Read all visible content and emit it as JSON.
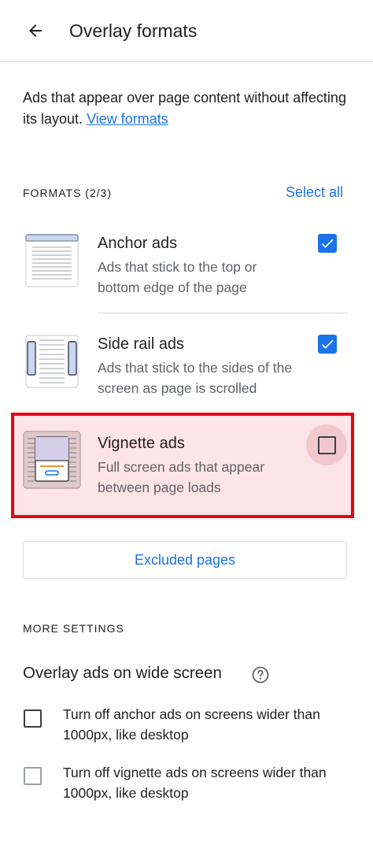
{
  "header": {
    "title": "Overlay formats",
    "back_icon": "arrow-back-icon"
  },
  "intro": {
    "text": "Ads that appear over page content without affecting its layout.",
    "link_label": "View formats"
  },
  "formats_section": {
    "label": "FORMATS (2/3)",
    "select_all_label": "Select all",
    "items": [
      {
        "name": "Anchor ads",
        "description": "Ads that stick to the top or bottom edge of the page",
        "checked": true,
        "thumbnail_icon": "anchor-ads-thumbnail-icon"
      },
      {
        "name": "Side rail ads",
        "description": "Ads that stick to the sides of the screen as page is scrolled",
        "checked": true,
        "thumbnail_icon": "side-rail-ads-thumbnail-icon"
      },
      {
        "name": "Vignette ads",
        "description": "Full screen ads that appear between page loads",
        "checked": false,
        "highlighted": true,
        "thumbnail_icon": "vignette-ads-thumbnail-icon"
      }
    ]
  },
  "excluded_pages_button": "Excluded pages",
  "more_settings": {
    "label": "MORE SETTINGS",
    "subheading": "Overlay ads on wide screen",
    "help_icon": "help-circle-icon",
    "options": [
      {
        "text": "Turn off anchor ads on screens wider than 1000px, like desktop",
        "checked": false
      },
      {
        "text": "Turn off vignette ads on screens wider than 1000px, like desktop",
        "checked": false
      }
    ]
  },
  "colors": {
    "accent": "#1a73e8",
    "highlight_border": "#e30613",
    "highlight_fill": "#fde4e6"
  }
}
